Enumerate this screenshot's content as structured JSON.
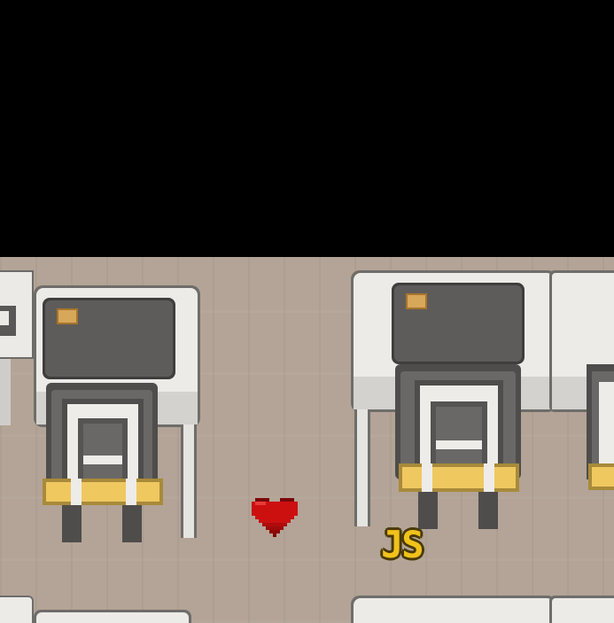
{
  "scene": {
    "floor_color": "#b3a497",
    "void_color": "#000000"
  },
  "player": {
    "label": "JS",
    "label_color": "#f2c21b"
  },
  "pickup": {
    "icon": "heart-icon",
    "color": "#cc1010"
  },
  "furniture": {
    "desk_color": "#e8e6e3",
    "monitor_color": "#5a5856",
    "sticky_note_color": "#d8a85a",
    "chair_seat_color": "#f0c860"
  }
}
